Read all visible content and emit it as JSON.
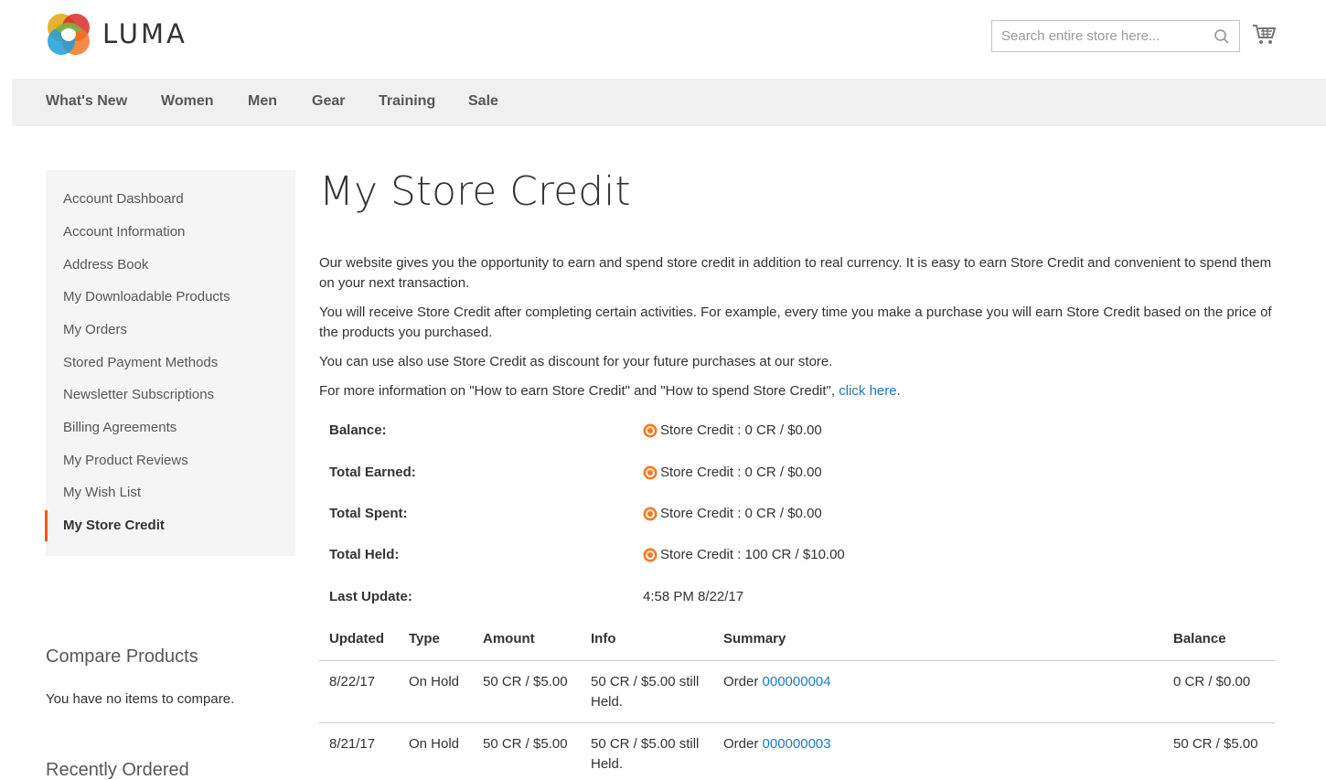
{
  "header": {
    "logo_text": "LUMA",
    "search_placeholder": "Search entire store here..."
  },
  "nav": {
    "items": [
      "What's New",
      "Women",
      "Men",
      "Gear",
      "Training",
      "Sale"
    ]
  },
  "sidebar": {
    "items": [
      "Account Dashboard",
      "Account Information",
      "Address Book",
      "My Downloadable Products",
      "My Orders",
      "Stored Payment Methods",
      "Newsletter Subscriptions",
      "Billing Agreements",
      "My Product Reviews",
      "My Wish List",
      "My Store Credit"
    ],
    "active_item": "My Store Credit"
  },
  "compare": {
    "title": "Compare Products",
    "text": "You have no items to compare."
  },
  "recently_ordered": {
    "title": "Recently Ordered"
  },
  "main": {
    "title": "My Store Credit",
    "paragraphs": [
      "Our website gives you the opportunity to earn and spend store credit in addition to real currency. It is easy to earn Store Credit and convenient to spend them on your next transaction.",
      "You will receive Store Credit after completing certain activities. For example, every time you make a purchase you will earn Store Credit based on the price of the products you purchased.",
      "You can use also use Store Credit as discount for your future purchases at our store."
    ],
    "more_info_text": "For more information on \"How to earn Store Credit\" and \"How to spend Store Credit\", ",
    "more_info_link": "click here",
    "more_info_suffix": "."
  },
  "summary": {
    "balance_label": "Balance:",
    "balance_value": "Store Credit : 0 CR / $0.00",
    "earned_label": "Total Earned:",
    "earned_value": "Store Credit : 0 CR / $0.00",
    "spent_label": "Total Spent:",
    "spent_value": "Store Credit : 0 CR / $0.00",
    "held_label": "Total Held:",
    "held_value": "Store Credit : 100 CR / $10.00",
    "update_label": "Last Update:",
    "update_value": "4:58 PM 8/22/17"
  },
  "table": {
    "headers": [
      "Updated",
      "Type",
      "Amount",
      "Info",
      "Summary",
      "Balance"
    ],
    "rows": [
      {
        "updated": "8/22/17",
        "type": "On Hold",
        "amount": "50 CR / $5.00",
        "info_line1": "50 CR / $5.00 still",
        "info_line2": "Held.",
        "summary_prefix": "Order ",
        "summary_link": "000000004",
        "balance": "0 CR / $0.00"
      },
      {
        "updated": "8/21/17",
        "type": "On Hold",
        "amount": "50 CR / $5.00",
        "info_line1": "50 CR / $5.00 still",
        "info_line2": "Held.",
        "summary_prefix": "Order ",
        "summary_link": "000000003",
        "balance": "50 CR / $5.00"
      }
    ]
  },
  "colors": {
    "accent": "#ff5501",
    "link": "#1979c3",
    "nav_bg": "#f0f0f0",
    "sidebar_bg": "#f5f5f5"
  }
}
